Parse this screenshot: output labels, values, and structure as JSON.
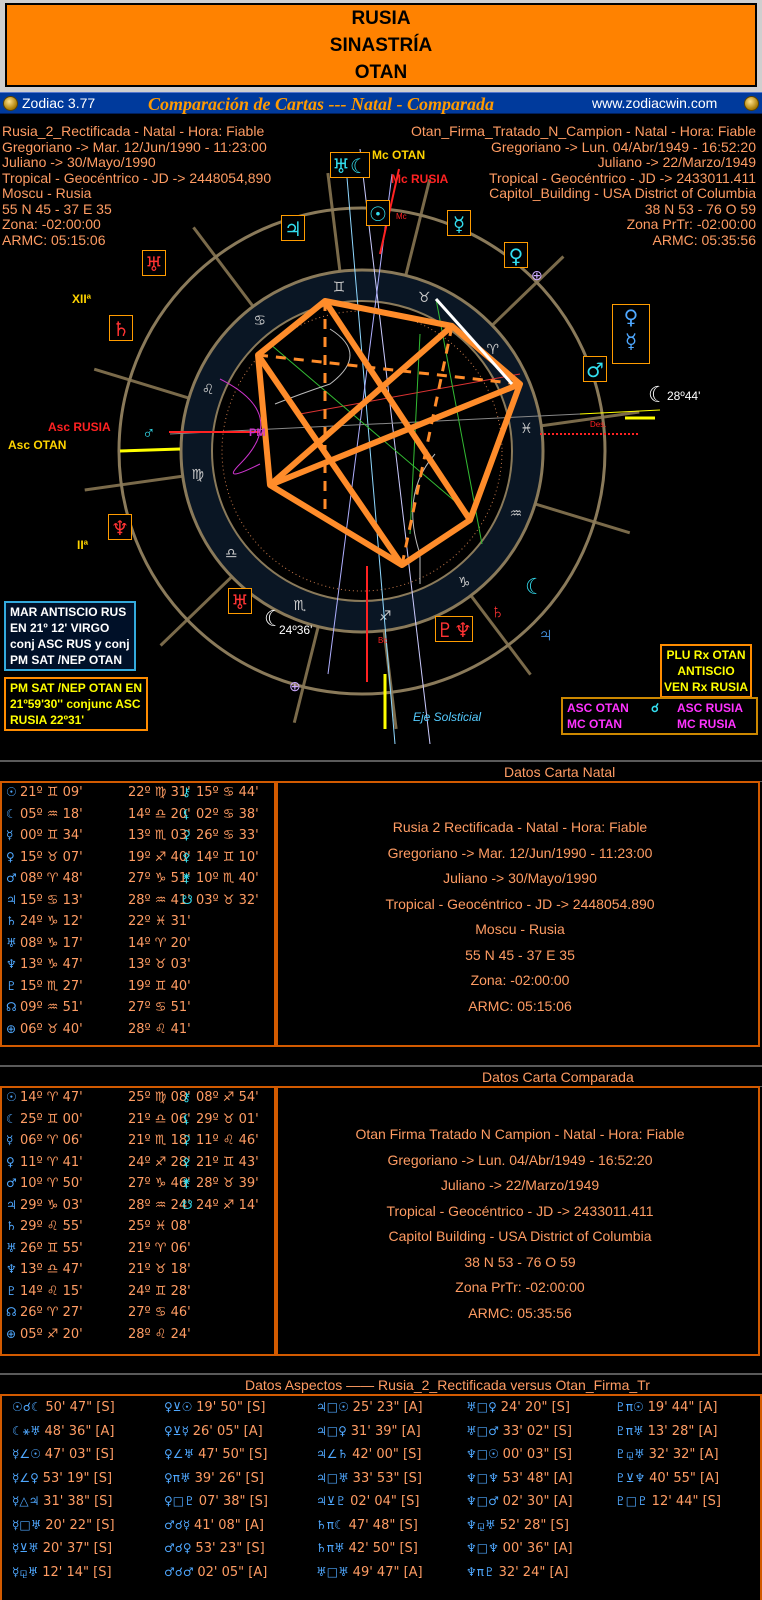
{
  "banner": {
    "line1": "RUSIA",
    "line2": "SINASTRÍA",
    "line3": "OTAN"
  },
  "titlebar": {
    "app": "Zodiac 3.77",
    "title": "Comparación de Cartas --- Natal - Comparada",
    "url": "www.zodiacwin.com"
  },
  "chart_left": [
    "Rusia_2_Rectificada - Natal - Hora: Fiable",
    "Gregoriano -> Mar. 12/Jun/1990 - 11:23:00",
    "Juliano -> 30/Mayo/1990",
    "Tropical - Geocéntrico - JD -> 2448054,890",
    "Moscu - Rusia",
    "55 N 45 - 37 E 35",
    "Zona: -02:00:00",
    "ARMC: 05:15:06"
  ],
  "chart_right": [
    "Otan_Firma_Tratado_N_Campion - Natal - Hora: Fiable",
    "Gregoriano -> Lun. 04/Abr/1949 - 16:52:20",
    "Juliano -> 22/Marzo/1949",
    "Tropical - Geocéntrico - JD -> 2433011.411",
    "Capitol_Building - USA District of Columbia",
    "38 N 53 - 76 O 59",
    "Zona PrTr: -02:00:00",
    "ARMC: 05:35:56"
  ],
  "chart_labels": {
    "mc_otan": "Mc OTAN",
    "mc_rusia": "Mc RUSIA",
    "mc_small": "Mc",
    "asc_rusia": "Asc RUSIA",
    "asc_otan": "Asc OTAN",
    "pm": "PM",
    "des": "Des.",
    "xii": "XIIª",
    "ii": "IIª",
    "bc": "Bc",
    "moon_deg": "28º44'",
    "venus_deg": "24º36'",
    "eje": "Eje Solsticial"
  },
  "zodiac_signs": [
    "♊",
    "♉",
    "♈",
    "♓",
    "♒",
    "♑",
    "♐",
    "♏",
    "♎",
    "♍",
    "♌",
    "♋"
  ],
  "annotations": {
    "mar_antiscio": [
      "MAR ANTISCIO RUS",
      "EN 21º 12' VIRGO",
      "conj ASC RUS y conj",
      "PM SAT /NEP OTAN"
    ],
    "pm_sat": [
      "PM SAT /NEP OTAN EN",
      "21º59'30'' conjunc ASC",
      "RUSIA 22º31'"
    ],
    "plu_rx": [
      "PLU Rx OTAN",
      "ANTISCIO",
      "VEN Rx RUSIA"
    ],
    "asc_otan_box": {
      "a": "ASC OTAN",
      "b": "MC OTAN",
      "c": "ASC RUSIA",
      "d": "MC RUSIA"
    }
  },
  "natal": {
    "title": "Datos Carta Natal",
    "rows": [
      [
        [
          "☉",
          "21º ♊ 09'"
        ],
        [
          "",
          "22º ♍ 31'"
        ],
        [
          "⚷",
          "15º ♋ 44'"
        ]
      ],
      [
        [
          "☾",
          "05º ♒ 18'"
        ],
        [
          "",
          "14º ♎ 20'"
        ],
        [
          "⚸",
          "02º ♋ 38'"
        ]
      ],
      [
        [
          "☿",
          "00º ♊ 34'"
        ],
        [
          "",
          "13º ♏ 03'"
        ],
        [
          "⚳",
          "26º ♋ 33'"
        ]
      ],
      [
        [
          "♀",
          "15º ♉ 07'"
        ],
        [
          "",
          "19º ♐ 40'"
        ],
        [
          "⚴",
          "14º ♊ 10'"
        ]
      ],
      [
        [
          "♂",
          "08º ♈ 48'"
        ],
        [
          "",
          "27º ♑ 51'"
        ],
        [
          "⚵",
          "10º ♏ 40'"
        ]
      ],
      [
        [
          "♃",
          "15º ♋ 13'"
        ],
        [
          "",
          "28º ♒ 41'"
        ],
        [
          "☋",
          "03º ♉ 32'"
        ]
      ],
      [
        [
          "♄",
          "24º ♑ 12'"
        ],
        [
          "",
          "22º ♓ 31'"
        ],
        [
          "",
          ""
        ]
      ],
      [
        [
          "♅",
          "08º ♑ 17'"
        ],
        [
          "",
          "14º ♈ 20'"
        ],
        [
          "",
          ""
        ]
      ],
      [
        [
          "♆",
          "13º ♑ 47'"
        ],
        [
          "",
          "13º ♉ 03'"
        ],
        [
          "",
          ""
        ]
      ],
      [
        [
          "♇",
          "15º ♏ 27'"
        ],
        [
          "",
          "19º ♊ 40'"
        ],
        [
          "",
          ""
        ]
      ],
      [
        [
          "☊",
          "09º ♒ 51'"
        ],
        [
          "",
          "27º ♋ 51'"
        ],
        [
          "",
          ""
        ]
      ],
      [
        [
          "⊕",
          "06º ♉ 40'"
        ],
        [
          "",
          "28º ♌ 41'"
        ],
        [
          "",
          ""
        ]
      ]
    ],
    "info": [
      "Rusia 2 Rectificada - Natal - Hora: Fiable",
      "Gregoriano -> Mar. 12/Jun/1990 - 11:23:00",
      "Juliano -> 30/Mayo/1990",
      "Tropical - Geocéntrico - JD -> 2448054.890",
      "Moscu - Rusia",
      "55 N 45 - 37 E 35",
      "Zona: -02:00:00",
      "ARMC: 05:15:06"
    ]
  },
  "comparada": {
    "title": "Datos Carta Comparada",
    "rows": [
      [
        [
          "☉",
          "14º ♈ 47'"
        ],
        [
          "",
          "25º ♍ 08'"
        ],
        [
          "⚷",
          "08º ♐ 54'"
        ]
      ],
      [
        [
          "☾",
          "25º ♊ 00'"
        ],
        [
          "",
          "21º ♎ 06'"
        ],
        [
          "⚸",
          "29º ♉ 01'"
        ]
      ],
      [
        [
          "☿",
          "06º ♈ 06'"
        ],
        [
          "",
          "21º ♏ 18'"
        ],
        [
          "⚳",
          "11º ♌ 46'"
        ]
      ],
      [
        [
          "♀",
          "11º ♈ 41'"
        ],
        [
          "",
          "24º ♐ 28'"
        ],
        [
          "⚴",
          "21º ♊ 43'"
        ]
      ],
      [
        [
          "♂",
          "10º ♈ 50'"
        ],
        [
          "",
          "27º ♑ 46'"
        ],
        [
          "⚵",
          "28º ♉ 39'"
        ]
      ],
      [
        [
          "♃",
          "29º ♑ 03'"
        ],
        [
          "",
          "28º ♒ 24'"
        ],
        [
          "☋",
          "24º ♐ 14'"
        ]
      ],
      [
        [
          "♄",
          "29º ♌ 55'"
        ],
        [
          "",
          "25º ♓ 08'"
        ],
        [
          "",
          ""
        ]
      ],
      [
        [
          "♅",
          "26º ♊ 55'"
        ],
        [
          "",
          "21º ♈ 06'"
        ],
        [
          "",
          ""
        ]
      ],
      [
        [
          "♆",
          "13º ♎ 47'"
        ],
        [
          "",
          "21º ♉ 18'"
        ],
        [
          "",
          ""
        ]
      ],
      [
        [
          "♇",
          "14º ♌ 15'"
        ],
        [
          "",
          "24º ♊ 28'"
        ],
        [
          "",
          ""
        ]
      ],
      [
        [
          "☊",
          "26º ♈ 27'"
        ],
        [
          "",
          "27º ♋ 46'"
        ],
        [
          "",
          ""
        ]
      ],
      [
        [
          "⊕",
          "05º ♐ 20'"
        ],
        [
          "",
          "28º ♌ 24'"
        ],
        [
          "",
          ""
        ]
      ]
    ],
    "info": [
      "Otan Firma Tratado N Campion - Natal - Hora: Fiable",
      "Gregoriano -> Lun. 04/Abr/1949 - 16:52:20",
      "Juliano -> 22/Marzo/1949",
      "Tropical - Geocéntrico - JD -> 2433011.411",
      "Capitol Building - USA District of Columbia",
      "38 N 53 - 76 O 59",
      "Zona PrTr: -02:00:00",
      "ARMC: 05:35:56"
    ]
  },
  "aspects": {
    "title": "Datos Aspectos   ——   Rusia_2_Rectificada   versus   Otan_Firma_Tr",
    "columns": [
      [
        [
          "☉☌☾",
          "50' 47\" [S]"
        ],
        [
          "☾⚹♅",
          "48' 36\" [A]"
        ],
        [
          "☿∠☉",
          "47' 03\" [S]"
        ],
        [
          "☿∠♀",
          "53' 19\" [S]"
        ],
        [
          "☿△♃",
          "31' 38\" [S]"
        ],
        [
          "☿□♅",
          "20' 22\" [S]"
        ],
        [
          "☿⊻♅",
          "20' 37\" [S]"
        ],
        [
          "☿⚼♅",
          "12' 14\" [S]"
        ]
      ],
      [
        [
          "♀⊻☉",
          "19' 50\" [S]"
        ],
        [
          "♀⊻☿",
          "26' 05\" [A]"
        ],
        [
          "♀∠♅",
          "47' 50\" [S]"
        ],
        [
          "♀π♅",
          "39' 26\" [S]"
        ],
        [
          "♀□♇",
          "07' 38\" [S]"
        ],
        [
          "♂☌☿",
          "41' 08\" [A]"
        ],
        [
          "♂☌♀",
          "53' 23\" [S]"
        ],
        [
          "♂☌♂",
          "02' 05\" [A]"
        ]
      ],
      [
        [
          "♃□☉",
          "25' 23\" [A]"
        ],
        [
          "♃□♀",
          "31' 39\" [A]"
        ],
        [
          "♃∠♄",
          "42' 00\" [S]"
        ],
        [
          "♃□♅",
          "33' 53\" [S]"
        ],
        [
          "♃⊻♇",
          "02' 04\" [S]"
        ],
        [
          "♄π☾",
          "47' 48\" [S]"
        ],
        [
          "♄π♅",
          "42' 50\" [S]"
        ],
        [
          "♅□♅",
          "49' 47\" [A]"
        ]
      ],
      [
        [
          "♅□♀",
          "24' 20\" [S]"
        ],
        [
          "♅□♂",
          "33' 02\" [S]"
        ],
        [
          "♆□☉",
          "00' 03\" [S]"
        ],
        [
          "♆□♆",
          "53' 48\" [A]"
        ],
        [
          "♆□♂",
          "02' 30\" [A]"
        ],
        [
          "♆⚼♅",
          "52' 28\" [S]"
        ],
        [
          "♆□♆",
          "00' 36\" [A]"
        ],
        [
          "♆π♇",
          "32' 24\" [A]"
        ]
      ],
      [
        [
          "♇π☉",
          "19' 44\" [A]"
        ],
        [
          "♇π♅",
          "13' 28\" [A]"
        ],
        [
          "♇⚼♅",
          "32' 32\" [A]"
        ],
        [
          "♇⊻♆",
          "40' 55\" [A]"
        ],
        [
          "♇□♇",
          "12' 44\" [S]"
        ]
      ]
    ]
  },
  "colors": {
    "orange_text": "#ff9c63",
    "banner": "#ff8200",
    "titlebar": "#003a9c",
    "chart_line": "#ff8c2a",
    "blue_glyph": "#4fa8ff"
  }
}
